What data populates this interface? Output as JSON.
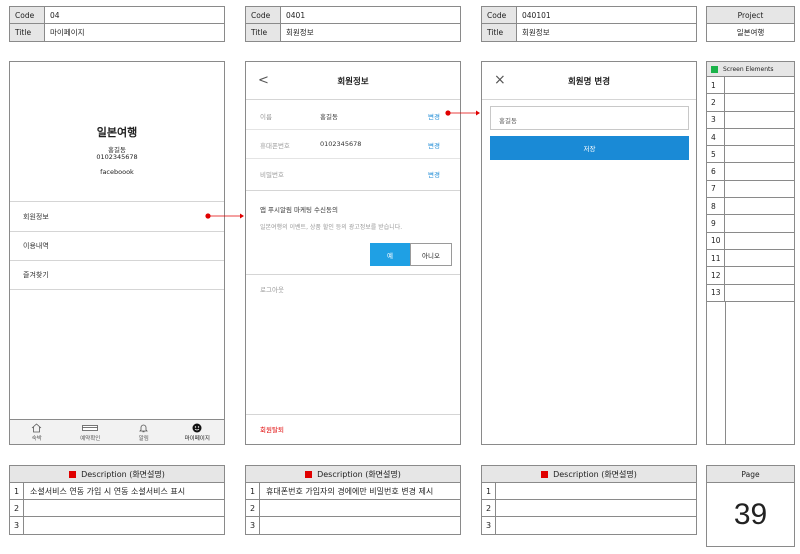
{
  "header": {
    "screen1": {
      "code_key": "Code",
      "code": "04",
      "title_key": "Title",
      "title": "마이페이지"
    },
    "screen2": {
      "code_key": "Code",
      "code": "0401",
      "title_key": "Title",
      "title": "회원정보"
    },
    "screen3": {
      "code_key": "Code",
      "code": "040101",
      "title_key": "Title",
      "title": "회원정보"
    },
    "project": {
      "label": "Project",
      "value": "일본여행"
    }
  },
  "mypage": {
    "app_name": "일본여행",
    "user_name": "홍길동",
    "phone": "0102345678",
    "login_type": "faceboook",
    "menu": [
      "회원정보",
      "이용내역",
      "즐겨찾기"
    ],
    "tabs": [
      {
        "label": "숙박",
        "icon": "home-icon"
      },
      {
        "label": "예약확인",
        "icon": "card-icon"
      },
      {
        "label": "알림",
        "icon": "bell-icon"
      },
      {
        "label": "마이페이지",
        "icon": "smiley-icon"
      }
    ]
  },
  "member_info": {
    "title": "회원정보",
    "back_icon": "<",
    "rows": [
      {
        "label": "이름",
        "value": "홍길동",
        "action": "변경"
      },
      {
        "label": "휴대폰번호",
        "value": "0102345678",
        "action": "변경"
      },
      {
        "label": "비밀번호",
        "value": "",
        "action": "변경"
      }
    ],
    "push_title": "앱 푸시알림 마케팅 수신동의",
    "push_desc": "일본여행의 이벤트, 상품 할인 등의 광고정보를 받습니다.",
    "yes": "예",
    "no": "아니오",
    "logout": "로그아웃",
    "withdraw": "회원탈퇴"
  },
  "name_change": {
    "title": "회원명 변경",
    "close_icon": "×",
    "input_value": "홍길동",
    "save": "저장"
  },
  "screen_elements": {
    "title": "Screen Elements",
    "rows": [
      "1",
      "2",
      "3",
      "4",
      "5",
      "6",
      "7",
      "8",
      "9",
      "10",
      "11",
      "12",
      "13"
    ]
  },
  "descriptions": [
    {
      "title": "Description (화면설명)",
      "rows": [
        {
          "n": "1",
          "text": "소셜서비스 연동 가입 시 연동 소셜서비스 표시"
        },
        {
          "n": "2",
          "text": ""
        },
        {
          "n": "3",
          "text": ""
        }
      ]
    },
    {
      "title": "Description (화면설명)",
      "rows": [
        {
          "n": "1",
          "text": "휴대폰번호 가입자의 경에에만 비밀번호 변경 제시"
        },
        {
          "n": "2",
          "text": ""
        },
        {
          "n": "3",
          "text": ""
        }
      ]
    },
    {
      "title": "Description (화면설명)",
      "rows": [
        {
          "n": "1",
          "text": ""
        },
        {
          "n": "2",
          "text": ""
        },
        {
          "n": "3",
          "text": ""
        }
      ]
    }
  ],
  "page": {
    "label": "Page",
    "number": "39"
  },
  "colors": {
    "link_blue": "#1a8ad6",
    "button_blue": "#1fa0e4",
    "marker_red": "#e00000",
    "green": "#1bb34a"
  }
}
